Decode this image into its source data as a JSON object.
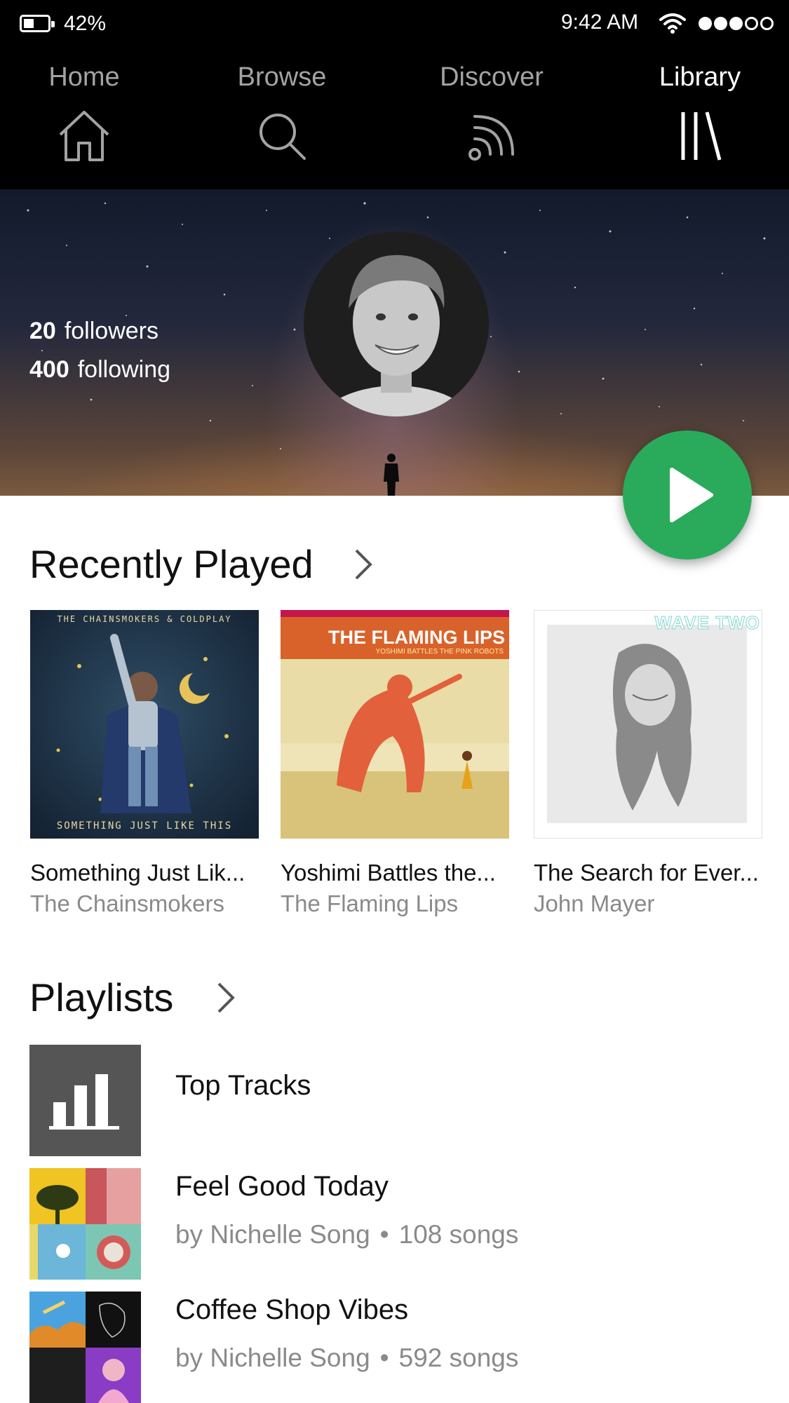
{
  "status_bar": {
    "battery": "42%",
    "time": "9:42 AM"
  },
  "nav": {
    "tabs": [
      {
        "label": "Home",
        "icon": "home-icon"
      },
      {
        "label": "Browse",
        "icon": "search-icon"
      },
      {
        "label": "Discover",
        "icon": "broadcast-icon"
      },
      {
        "label": "Library",
        "icon": "library-icon",
        "active": true
      }
    ]
  },
  "profile": {
    "followers_count": "20",
    "followers_label": "followers",
    "following_count": "400",
    "following_label": "following"
  },
  "recently_played": {
    "title": "Recently Played",
    "albums": [
      {
        "name": "Something Just Lik...",
        "artist": "The Chainsmokers",
        "cover_top_text": "THE CHAINSMOKERS & COLDPLAY",
        "cover_bottom_text": "SOMETHING JUST LIKE THIS"
      },
      {
        "name": "Yoshimi Battles the...",
        "artist": "The Flaming Lips",
        "cover_top_text": "THE FLAMING LIPS",
        "cover_sub_text": "YOSHIMI BATTLES THE PINK ROBOTS"
      },
      {
        "name": "The Search for Ever...",
        "artist": "John Mayer",
        "cover_top_text": "WAVE TWO"
      }
    ]
  },
  "playlists": {
    "title": "Playlists",
    "items": [
      {
        "title": "Top Tracks"
      },
      {
        "title": "Feel Good Today",
        "owner": "by Nichelle Song",
        "dot": "•",
        "count": "108 songs"
      },
      {
        "title": "Coffee Shop Vibes",
        "owner": "by Nichelle Song",
        "dot": "•",
        "count": "592 songs"
      }
    ]
  },
  "colors": {
    "accent_green": "#2aab5b",
    "nav_background": "#000000",
    "muted_text": "#8a8a8a"
  }
}
